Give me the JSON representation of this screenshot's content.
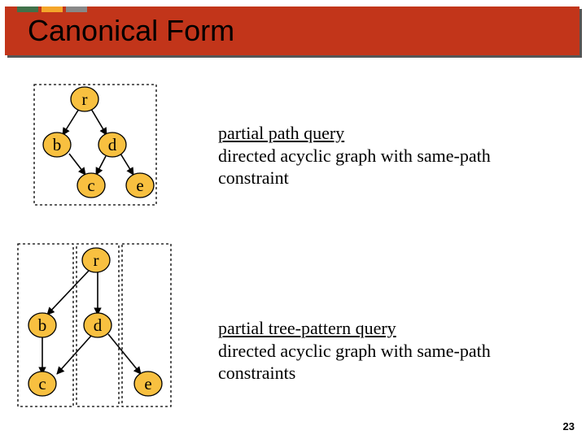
{
  "title": "Canonical Form",
  "tabs": [
    "#40724a",
    "#f4a62a",
    "#888888"
  ],
  "pagenum": "23",
  "caption1": {
    "u": "partial path query",
    "rest": "directed acyclic graph with same-path constraint"
  },
  "caption2": {
    "u": "partial tree-pattern query",
    "rest": "directed acyclic graph with same-path constraints"
  },
  "dag1": {
    "r": "r",
    "b": "b",
    "d": "d",
    "c": "c",
    "e": "e"
  },
  "dag2": {
    "r": "r",
    "b": "b",
    "d": "d",
    "c": "c",
    "e": "e"
  }
}
